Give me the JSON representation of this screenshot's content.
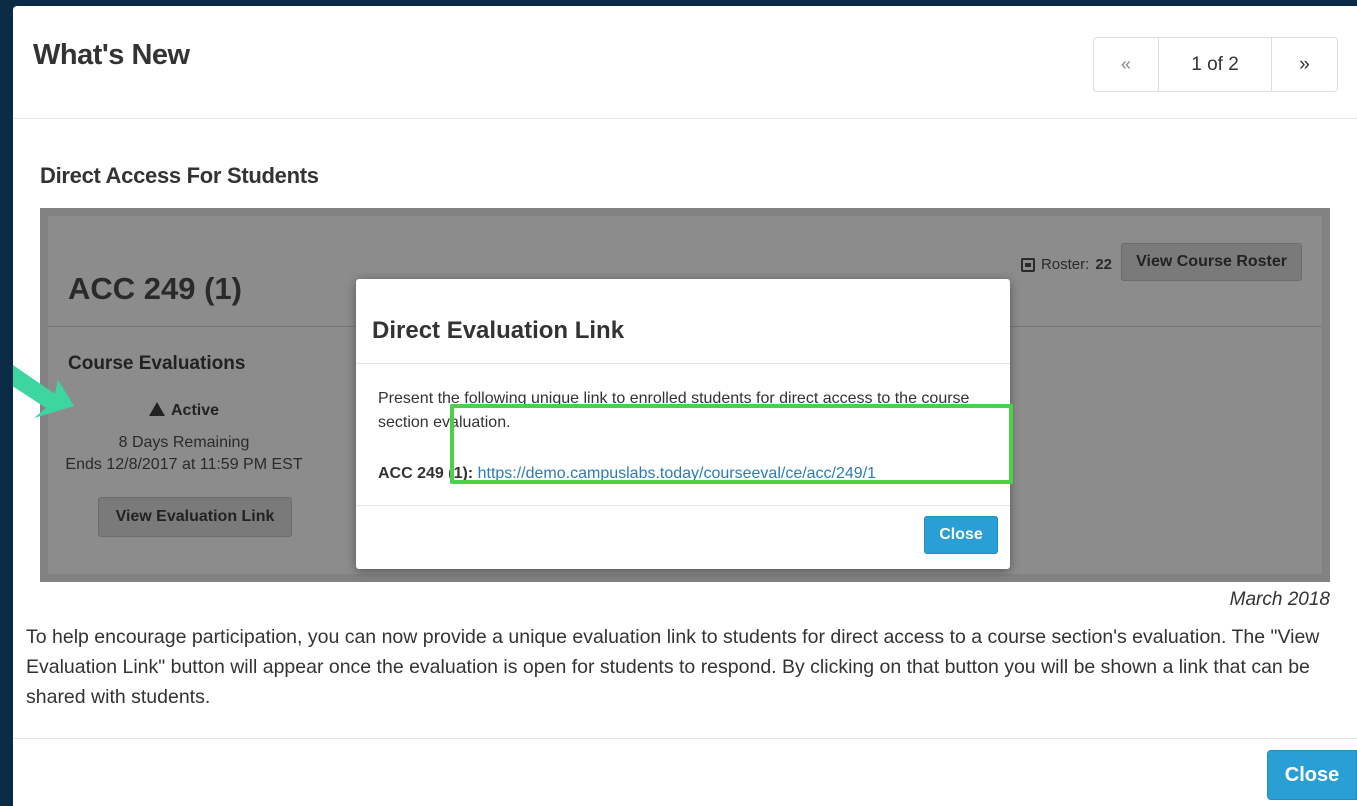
{
  "modal": {
    "title": "What's New",
    "pager": {
      "prev": "«",
      "page": "1 of 2",
      "next": "»"
    }
  },
  "article": {
    "heading": "Direct Access For Students",
    "date": "March 2018",
    "description": "To help encourage participation, you can now provide a unique evaluation link to students for direct access to a course section's evaluation. The \"View Evaluation Link\" button will appear once the evaluation is open for students to respond. By clicking on that button you will be shown a link that can be shared with students."
  },
  "screenshot": {
    "course_title": "ACC 249 (1)",
    "roster_label": "Roster:",
    "roster_count": "22",
    "roster_button": "View Course Roster",
    "eval_title": "Course Evaluations",
    "status": "Active",
    "remaining": "8 Days Remaining",
    "ends": "Ends 12/8/2017 at 11:59 PM EST",
    "eval_link_button": "View Evaluation Link",
    "dialog": {
      "title": "Direct Evaluation Link",
      "body": "Present the following unique link to enrolled students for direct access to the course section evaluation.",
      "link_label": "ACC 249 (1):",
      "link_url": "https://demo.campuslabs.today/courseeval/ce/acc/249/1",
      "close": "Close"
    },
    "highlight_color": "#4bd047",
    "arrow_color": "#3dd6a0"
  },
  "footer": {
    "close": "Close"
  },
  "colors": {
    "accent": "#2a9fd6",
    "backdrop": "#0b2a45"
  }
}
